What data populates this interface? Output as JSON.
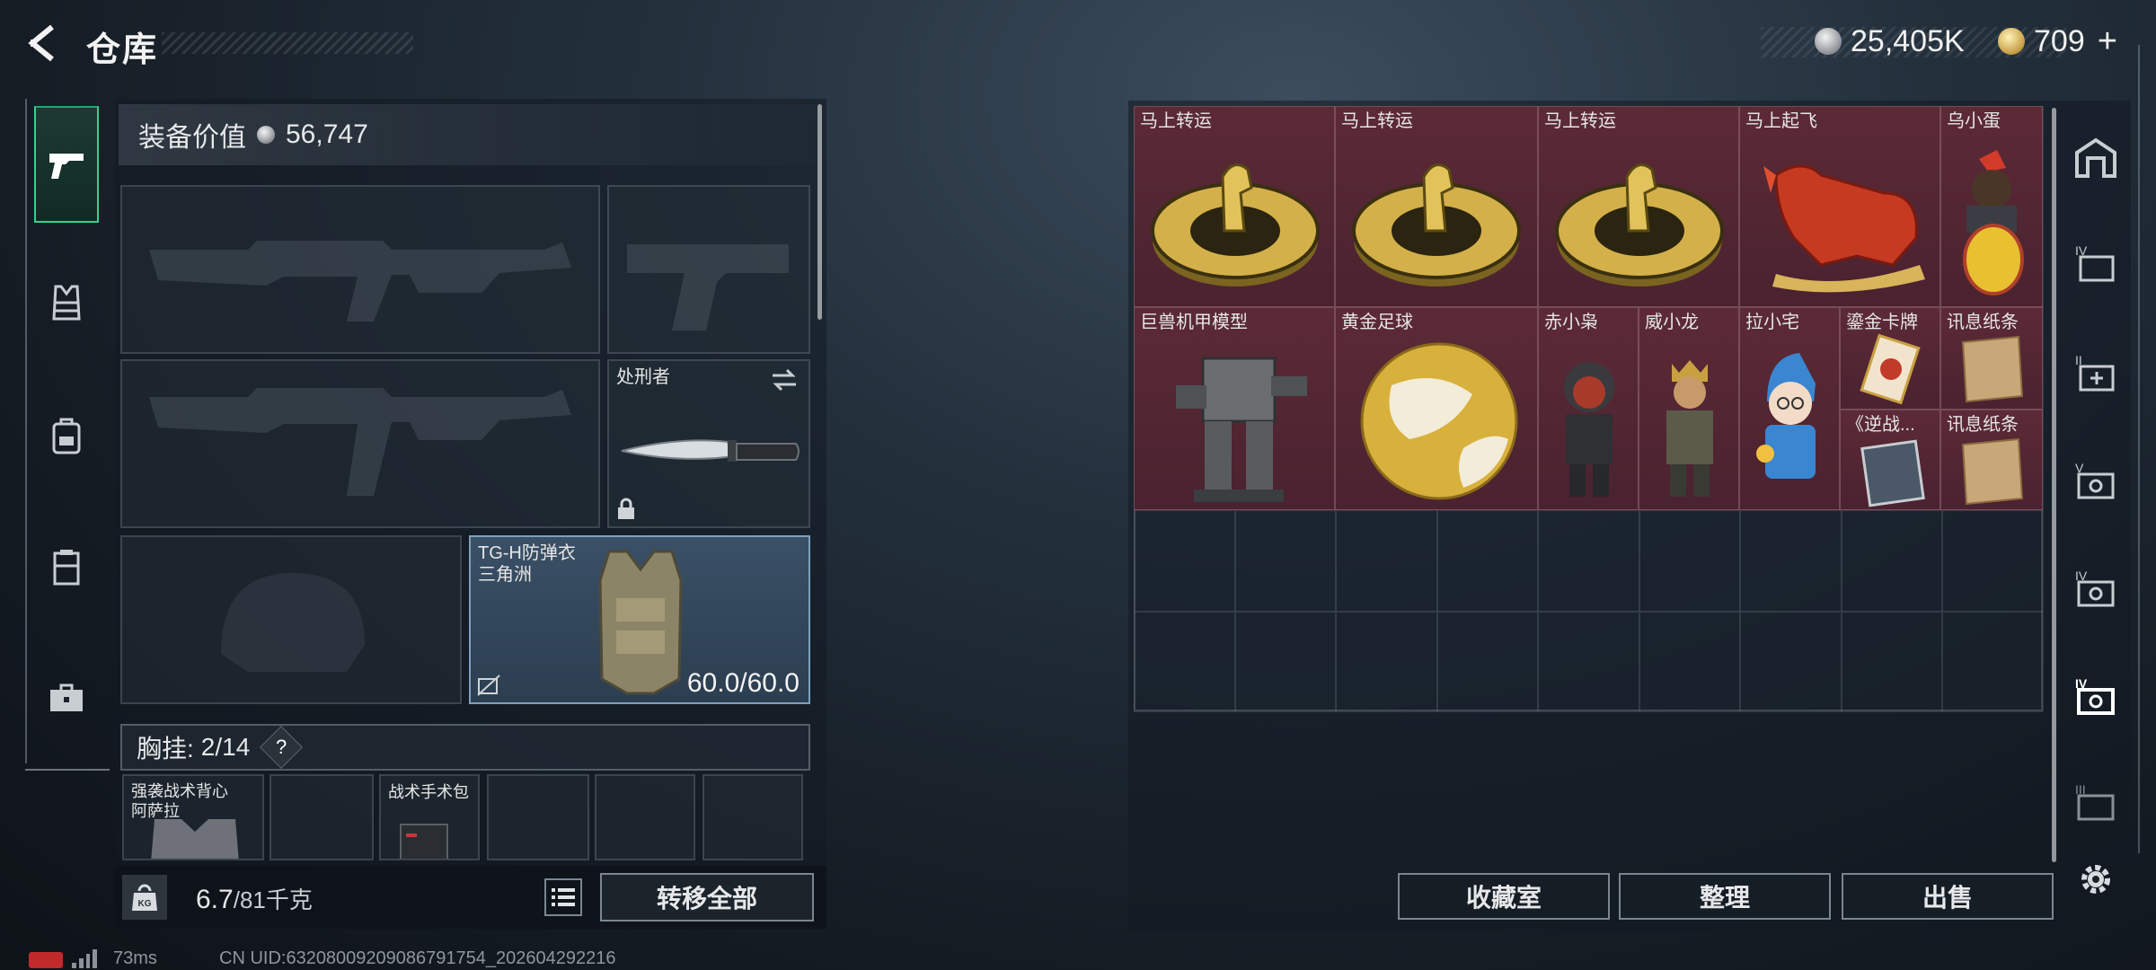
{
  "header": {
    "title": "仓库",
    "currency_silver": "25,405K",
    "currency_gold": "709",
    "plus_label": "+"
  },
  "equipment": {
    "value_label": "装备价值",
    "value_amount": "56,747",
    "melee_name": "处刑者",
    "armor_name_line1": "TG-H防弹衣",
    "armor_name_line2": "三角洲",
    "armor_durability": "60.0/60.0",
    "chest_rig_label": "胸挂:",
    "chest_rig_count": "2/14",
    "help_label": "?",
    "rig_items": [
      {
        "label": "强袭战术背心\n阿萨拉"
      },
      {
        "label": ""
      },
      {
        "label": "战术手术包"
      },
      {
        "label": ""
      },
      {
        "label": ""
      },
      {
        "label": ""
      }
    ]
  },
  "bottom_left": {
    "weight_value": "6.7",
    "weight_limit": "/81千克",
    "weight_icon_label": "KG",
    "transfer_all": "转移全部"
  },
  "storage": {
    "items": [
      {
        "name": "马上转运",
        "icon": "horse-coin-icon"
      },
      {
        "name": "马上转运",
        "icon": "horse-coin-icon"
      },
      {
        "name": "马上转运",
        "icon": "horse-coin-icon"
      },
      {
        "name": "马上起飞",
        "icon": "red-horse-icon"
      },
      {
        "name": "乌小蛋",
        "icon": "egg-figure-icon"
      },
      {
        "name": "巨兽机甲模型",
        "icon": "mech-model-icon"
      },
      {
        "name": "黄金足球",
        "icon": "golden-ball-icon"
      },
      {
        "name": "赤小枭",
        "icon": "figure-red-icon"
      },
      {
        "name": "威小龙",
        "icon": "figure-soldier-icon"
      },
      {
        "name": "拉小宅",
        "icon": "figure-blue-icon"
      },
      {
        "name": "鎏金卡牌",
        "icon": "gold-card-icon"
      },
      {
        "name": "讯息纸条",
        "icon": "paper-note-icon"
      },
      {
        "name": "《逆战...",
        "icon": "game-card-icon"
      },
      {
        "name": "讯息纸条",
        "icon": "paper-note-icon"
      }
    ],
    "actions": {
      "collection": "收藏室",
      "sort": "整理",
      "sell": "出售"
    }
  },
  "side_tabs": [
    "home-icon",
    "tier-4-box-icon",
    "add-box-icon",
    "tier-5-case-icon",
    "tier-4-case-icon",
    "tier-4-case-selected-icon",
    "tier-3-case-icon"
  ],
  "status": {
    "ping": "73ms",
    "uid": "CN UID:63208009209086791754_202604292216"
  },
  "colors": {
    "accent_green": "#3ad08e",
    "rare_item_bg": "#5c2a36",
    "armor_slot_bg": "#3a5066"
  }
}
